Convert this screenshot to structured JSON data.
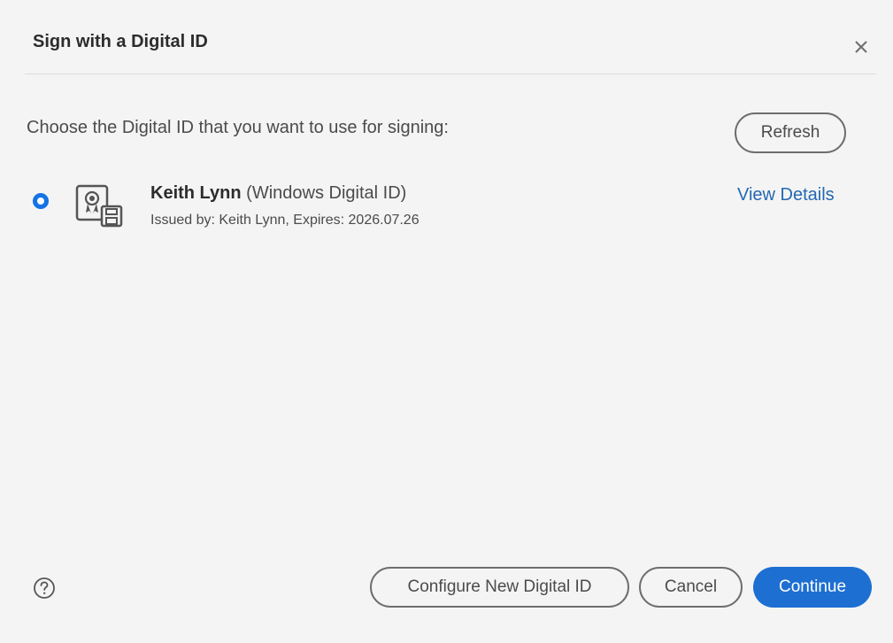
{
  "dialog": {
    "title": "Sign with a Digital ID",
    "close_icon": "close-icon"
  },
  "content": {
    "prompt": "Choose the Digital ID that you want to use for signing:",
    "refresh_label": "Refresh",
    "digital_ids": [
      {
        "selected": true,
        "name": "Keith Lynn",
        "type": "(Windows Digital ID)",
        "details": "Issued by: Keith Lynn, Expires: 2026.07.26",
        "icon": "certificate-icon",
        "view_details_label": "View Details"
      }
    ]
  },
  "footer": {
    "help_icon": "help-icon",
    "configure_label": "Configure New Digital ID",
    "cancel_label": "Cancel",
    "continue_label": "Continue"
  },
  "colors": {
    "accent": "#1473e6",
    "primary_button": "#1d6fd2",
    "link": "#2368b1",
    "background": "#f4f4f4"
  }
}
